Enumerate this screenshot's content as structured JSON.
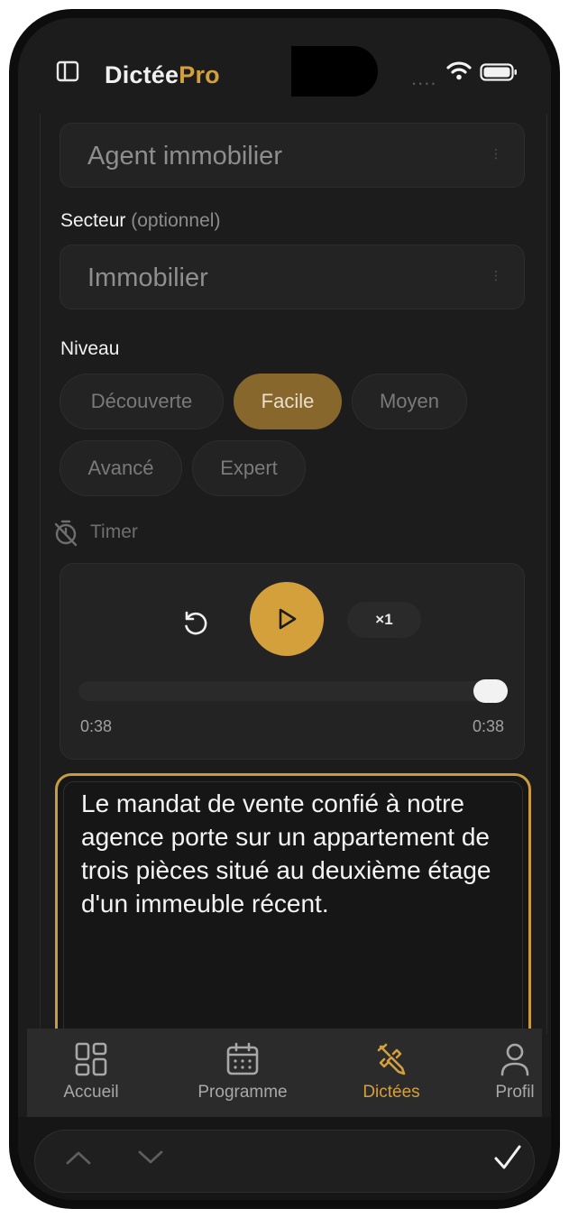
{
  "header": {
    "brand_main": "Dictée",
    "brand_accent": "Pro",
    "signal_dots": "....",
    "icons": [
      "sidebar-icon",
      "wifi-icon",
      "battery-icon"
    ]
  },
  "form": {
    "job_value": "Agent immobilier",
    "sector_label": "Secteur",
    "sector_optional": "(optionnel)",
    "sector_value": "Immobilier",
    "level_label": "Niveau",
    "levels": [
      "Découverte",
      "Facile",
      "Moyen",
      "Avancé",
      "Expert"
    ],
    "selected_level": "Facile",
    "timer_label": "Timer"
  },
  "player": {
    "speed": "×1",
    "elapsed": "0:38",
    "duration": "0:38",
    "progress": 1.0
  },
  "dictation": {
    "text": "Le mandat de vente confié à notre agence porte sur un appartement de trois pièces situé au deuxième étage d'un immeuble récent."
  },
  "tabs": [
    {
      "label": "Accueil",
      "icon": "grid-icon"
    },
    {
      "label": "Programme",
      "icon": "calendar-icon"
    },
    {
      "label": "Dictées",
      "icon": "pencil-icon"
    },
    {
      "label": "Profil",
      "icon": "user-icon"
    }
  ],
  "active_tab": "Dictées",
  "colors": {
    "accent": "#d4a03c",
    "background": "#1c1c1c",
    "surface": "#232323"
  }
}
